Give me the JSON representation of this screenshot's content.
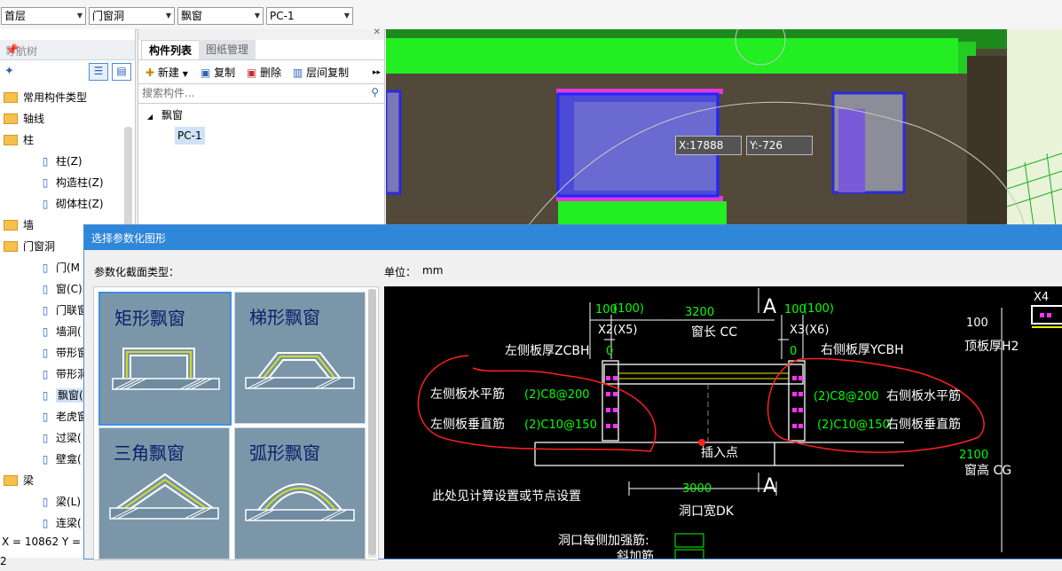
{
  "top_selectors": [
    {
      "value": "首层"
    },
    {
      "value": "门窗洞"
    },
    {
      "value": "飘窗"
    },
    {
      "value": "PC-1"
    }
  ],
  "nav": {
    "title": "导航树",
    "items": [
      {
        "label": "常用构件类型",
        "kind": "folder"
      },
      {
        "label": "轴线",
        "kind": "folder"
      },
      {
        "label": "柱",
        "kind": "folder-open"
      },
      {
        "label": "柱(Z)",
        "kind": "child"
      },
      {
        "label": "构造柱(Z)",
        "kind": "child"
      },
      {
        "label": "砌体柱(Z)",
        "kind": "child"
      },
      {
        "label": "墙",
        "kind": "folder"
      },
      {
        "label": "门窗洞",
        "kind": "folder-open"
      },
      {
        "label": "门(M",
        "kind": "child"
      },
      {
        "label": "窗(C)",
        "kind": "child"
      },
      {
        "label": "门联窗",
        "kind": "child"
      },
      {
        "label": "墙洞(",
        "kind": "child"
      },
      {
        "label": "带形窗",
        "kind": "child"
      },
      {
        "label": "带形洞",
        "kind": "child"
      },
      {
        "label": "飘窗(",
        "kind": "child-selected"
      },
      {
        "label": "老虎窗",
        "kind": "child"
      },
      {
        "label": "过梁(",
        "kind": "child"
      },
      {
        "label": "壁龛(",
        "kind": "child"
      },
      {
        "label": "梁",
        "kind": "folder-open"
      },
      {
        "label": "梁(L)",
        "kind": "child"
      },
      {
        "label": "连梁(",
        "kind": "child"
      }
    ]
  },
  "status": {
    "coords": "X = 10862 Y = 2"
  },
  "component_list": {
    "tabs": [
      "构件列表",
      "图纸管理"
    ],
    "toolbar": {
      "new": "新建",
      "copy": "复制",
      "delete": "删除",
      "floor_copy": "层间复制"
    },
    "search_placeholder": "搜索构件...",
    "tree_parent": "飘窗",
    "tree_child": "PC-1"
  },
  "view3d": {
    "x_readout": "X:17888",
    "y_readout": "Y:-726"
  },
  "dialog": {
    "title": "选择参数化图形",
    "section_type_label": "参数化截面类型：",
    "unit_label": "单位：",
    "unit_value": "mm",
    "thumbnails": [
      "矩形飘窗",
      "梯形飘窗",
      "三角飘窗",
      "弧形飘窗"
    ]
  },
  "cad": {
    "dim_100a": "100",
    "dim_100a_p": "(100)",
    "dim_3200": "3200",
    "dim_100b": "100",
    "dim_100b_p": "(100)",
    "x2": "X2(X5)",
    "window_len": "窗长 CC",
    "x3": "X3(X6)",
    "section_a": "A",
    "left_zero": "0",
    "left_thick": "左侧板厚ZCBH",
    "right_zero": "0",
    "right_thick": "右侧板厚YCBH",
    "left_h": "左侧板水平筋",
    "left_h_val": "(2)C8@200",
    "left_v": "左侧板垂直筋",
    "left_v_val": "(2)C10@150",
    "right_h": "右侧板水平筋",
    "right_h_val": "(2)C8@200",
    "right_v": "右侧板垂直筋",
    "right_v_val": "(2)C10@150",
    "insert_point": "插入点",
    "dim_3000": "3000",
    "opening_width": "洞口宽DK",
    "see_calc": "此处见计算设置或节点设置",
    "reinf_each_side": "洞口每侧加强筋:",
    "oblique": "斜加筋",
    "top_100": "100",
    "top_thick": "顶板厚H2",
    "x4": "X4",
    "dim_2100": "2100",
    "window_height": "窗高 CG"
  },
  "colors": {
    "dialog_title": "#2f87d9",
    "cad_bg": "#000000",
    "dim_green": "#00ff00",
    "annotation_red": "#ff2020"
  }
}
